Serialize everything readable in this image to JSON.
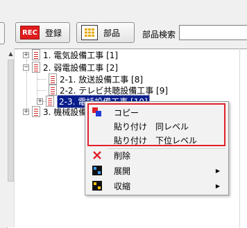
{
  "toolbar": {
    "rec_icon_text": "REC",
    "register_label": "登録",
    "parts_label": "部品",
    "search_label": "部品検索",
    "search_value": ""
  },
  "tree": {
    "nodes": [
      {
        "label": "1. 電気設備工事 [1]",
        "expander": "+"
      },
      {
        "label": "2. 弱電設備工事 [2]",
        "expander": "−"
      },
      {
        "label": "2-1. 放送設備工事 [8]",
        "expander": ""
      },
      {
        "label": "2-2. テレビ共聴設備工事 [9]",
        "expander": ""
      },
      {
        "label": "2-3. 電話設備工事 [10]",
        "expander": "+"
      },
      {
        "label": "3. 機械設備工事 [3]",
        "expander": "+"
      }
    ]
  },
  "context_menu": {
    "items": [
      {
        "label": "コピー",
        "icon": "copy-icon"
      },
      {
        "label": "貼り付け　同レベル",
        "icon": ""
      },
      {
        "label": "貼り付け　下位レベル",
        "icon": ""
      },
      {
        "label": "削除",
        "icon": "delete-x-icon"
      },
      {
        "label": "展開",
        "icon": "expand-icon",
        "submenu": "▶"
      },
      {
        "label": "収縮",
        "icon": "collapse-icon",
        "submenu": "▶"
      }
    ]
  },
  "colors": {
    "highlight_border": "#e3202c",
    "selection_bg": "#0a1e8c",
    "rec_red": "#e01b1b"
  }
}
